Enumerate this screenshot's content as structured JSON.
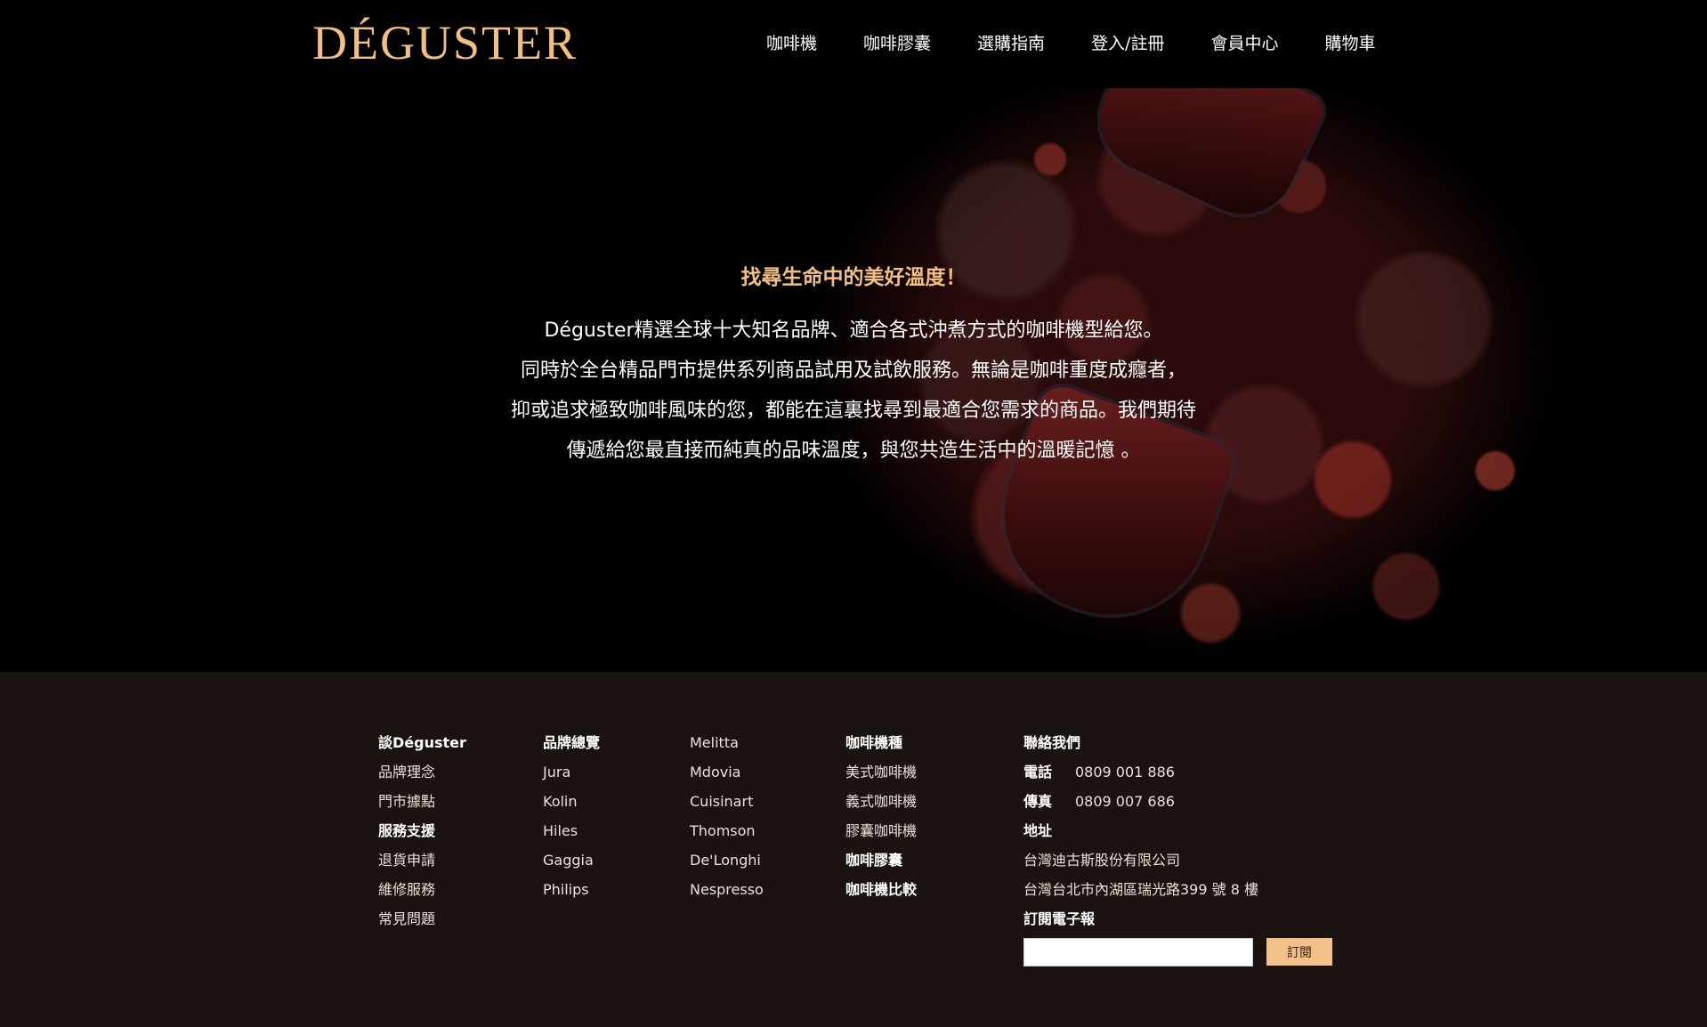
{
  "header": {
    "logo": "DÉGUSTER",
    "nav": [
      "咖啡機",
      "咖啡膠囊",
      "選購指南",
      "登入/註冊",
      "會員中心",
      "購物車"
    ]
  },
  "hero": {
    "title": "找尋生命中的美好溫度！",
    "lines": [
      "Déguster精選全球十大知名品牌、適合各式沖煮方式的咖啡機型給您。",
      "同時於全台精品門市提供系列商品試用及試飲服務。無論是咖啡重度成癮者，",
      "抑或追求極致咖啡風味的您，都能在這裏找尋到最適合您需求的商品。我們期待",
      "傳遞給您最直接而純真的品味溫度，與您共造生活中的溫暖記憶 。"
    ]
  },
  "footer": {
    "about": {
      "heading": "談Déguster",
      "items": [
        "品牌理念",
        "門市據點",
        "服務支援",
        "退貨申請",
        "維修服務",
        "常見問題"
      ]
    },
    "brands_a": {
      "heading": "品牌總覽",
      "items": [
        "Jura",
        "Kolin",
        "Hiles",
        "Gaggia",
        "Philips"
      ]
    },
    "brands_b": {
      "items": [
        "Melitta",
        "Mdovia",
        "Cuisinart",
        "Thomson",
        "De'Longhi",
        "Nespresso"
      ]
    },
    "machines": {
      "heading": "咖啡機種",
      "items": [
        "美式咖啡機",
        "義式咖啡機",
        "膠囊咖啡機",
        "咖啡膠囊",
        "咖啡機比較"
      ]
    },
    "contact": {
      "heading": "聯絡我們",
      "phone_label": "電話",
      "phone": "0809 001 886",
      "fax_label": "傳真",
      "fax": "0809 007 686",
      "address_label": "地址",
      "company": "台灣迪古斯股份有限公司",
      "address": "台灣台北市內湖區瑞光路399 號 8 樓",
      "newsletter_label": "訂閱電子報",
      "email_value": "",
      "subscribe_button": "訂閱"
    }
  },
  "colors": {
    "accent": "#f1bf80",
    "footer_bg": "#1b130f",
    "button_bg": "#f4c08a"
  }
}
